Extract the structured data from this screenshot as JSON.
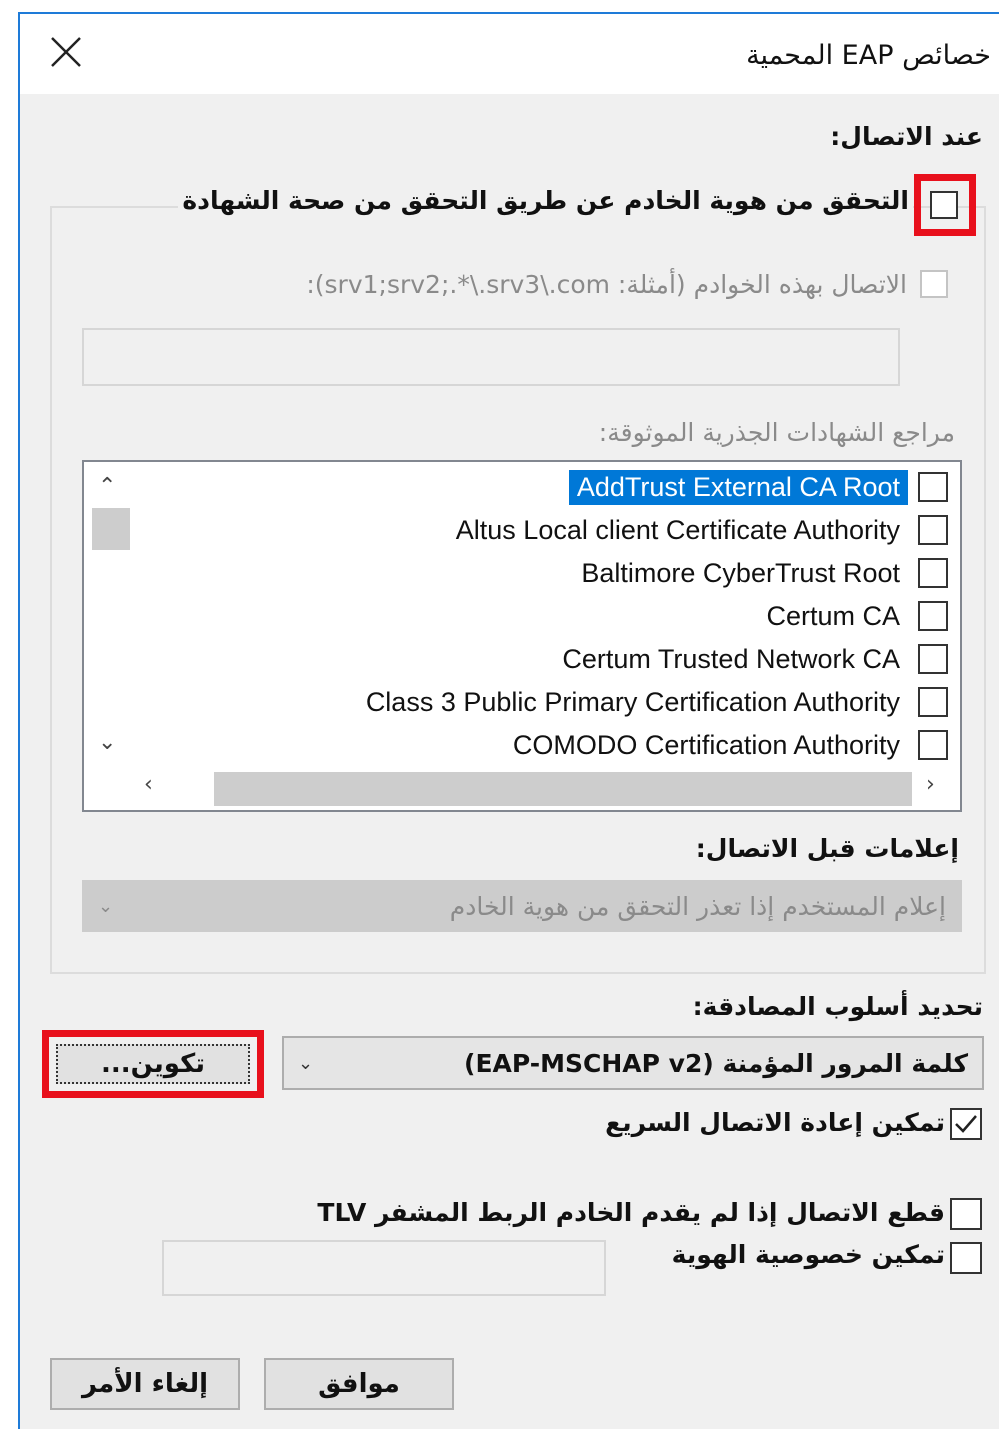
{
  "window": {
    "title": "خصائص EAP المحمية"
  },
  "connection": {
    "section_label": "عند الاتصال:",
    "verify_server_label": "التحقق من هوية الخادم عن طريق التحقق من صحة الشهادة",
    "verify_server_checked": false,
    "connect_servers_label": "الاتصال بهذه الخوادم (أمثلة: srv1;srv2;.*\\.srv3\\.com):",
    "connect_servers_value": "",
    "trusted_roots_label": "مراجع الشهادات الجذرية الموثوقة:",
    "trusted_roots": [
      {
        "label": "AddTrust External CA Root",
        "checked": false,
        "selected": true
      },
      {
        "label": "Altus Local client Certificate Authority",
        "checked": false,
        "selected": false
      },
      {
        "label": "Baltimore CyberTrust Root",
        "checked": false,
        "selected": false
      },
      {
        "label": "Certum CA",
        "checked": false,
        "selected": false
      },
      {
        "label": "Certum Trusted Network CA",
        "checked": false,
        "selected": false
      },
      {
        "label": "Class 3 Public Primary Certification Authority",
        "checked": false,
        "selected": false
      },
      {
        "label": "COMODO Certification Authority",
        "checked": false,
        "selected": false
      }
    ],
    "notifications_label": "إعلامات قبل الاتصال:",
    "notifications_value": "إعلام المستخدم إذا تعذر التحقق من هوية الخادم"
  },
  "auth": {
    "method_label": "تحديد أسلوب المصادقة:",
    "method_value": "كلمة المرور المؤمنة (EAP-MSCHAP v2)",
    "configure_label": "تكوين...",
    "fast_reconnect_label": "تمكين إعادة الاتصال السريع",
    "fast_reconnect_checked": true,
    "disconnect_tlv_label": "قطع الاتصال إذا لم يقدم الخادم الربط المشفر TLV",
    "disconnect_tlv_checked": false,
    "identity_privacy_label": "تمكين خصوصية الهوية",
    "identity_privacy_checked": false,
    "identity_value": ""
  },
  "buttons": {
    "ok": "موافق",
    "cancel": "إلغاء الأمر"
  },
  "colors": {
    "highlight_red": "#e8101c",
    "selection_blue": "#0078d7",
    "window_border": "#1e7bd8"
  }
}
